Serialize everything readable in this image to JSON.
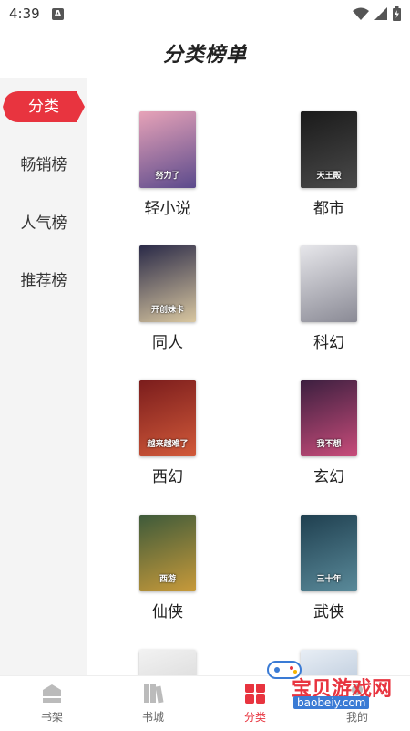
{
  "status_bar": {
    "time": "4:39",
    "badge": "A"
  },
  "header": {
    "title": "分类榜单"
  },
  "sidebar": {
    "items": [
      {
        "label": "分类",
        "active": true
      },
      {
        "label": "畅销榜",
        "active": false
      },
      {
        "label": "人气榜",
        "active": false
      },
      {
        "label": "推荐榜",
        "active": false
      }
    ]
  },
  "categories": [
    {
      "name": "轻小说",
      "cover_text": "努力了",
      "cover_colors": [
        "#e7a3b8",
        "#5b4a8c"
      ]
    },
    {
      "name": "都市",
      "cover_text": "天王殿",
      "cover_colors": [
        "#1a1a1a",
        "#4a4a4a"
      ]
    },
    {
      "name": "同人",
      "cover_text": "开创妹卡",
      "cover_colors": [
        "#2a2a48",
        "#d9c7a0"
      ]
    },
    {
      "name": "科幻",
      "cover_text": "",
      "cover_colors": [
        "#e6e6ea",
        "#8a8a95"
      ]
    },
    {
      "name": "西幻",
      "cover_text": "越来越难了",
      "cover_colors": [
        "#7a1c1c",
        "#d25a3a"
      ]
    },
    {
      "name": "玄幻",
      "cover_text": "我不想",
      "cover_colors": [
        "#3b1f3f",
        "#c84c7a"
      ]
    },
    {
      "name": "仙侠",
      "cover_text": "西游",
      "cover_colors": [
        "#3d5a3a",
        "#c89a3a"
      ]
    },
    {
      "name": "武侠",
      "cover_text": "三十年",
      "cover_colors": [
        "#1f3f4f",
        "#5a8a9a"
      ]
    },
    {
      "name": "",
      "cover_text": "",
      "cover_colors": [
        "#f2f2f2",
        "#cccccc"
      ]
    },
    {
      "name": "",
      "cover_text": "",
      "cover_colors": [
        "#e8eef5",
        "#a0b4cc"
      ]
    }
  ],
  "bottom_nav": {
    "items": [
      {
        "label": "书架",
        "icon": "bookshelf-icon",
        "active": false
      },
      {
        "label": "书城",
        "icon": "bookstore-icon",
        "active": false
      },
      {
        "label": "分类",
        "icon": "category-icon",
        "active": true
      },
      {
        "label": "我的",
        "icon": "profile-icon",
        "active": false
      }
    ]
  },
  "watermark": {
    "text": "宝贝游戏网",
    "url": "baobeiy.com"
  },
  "colors": {
    "accent": "#e8343f",
    "sidebar_bg": "#f4f4f4"
  }
}
